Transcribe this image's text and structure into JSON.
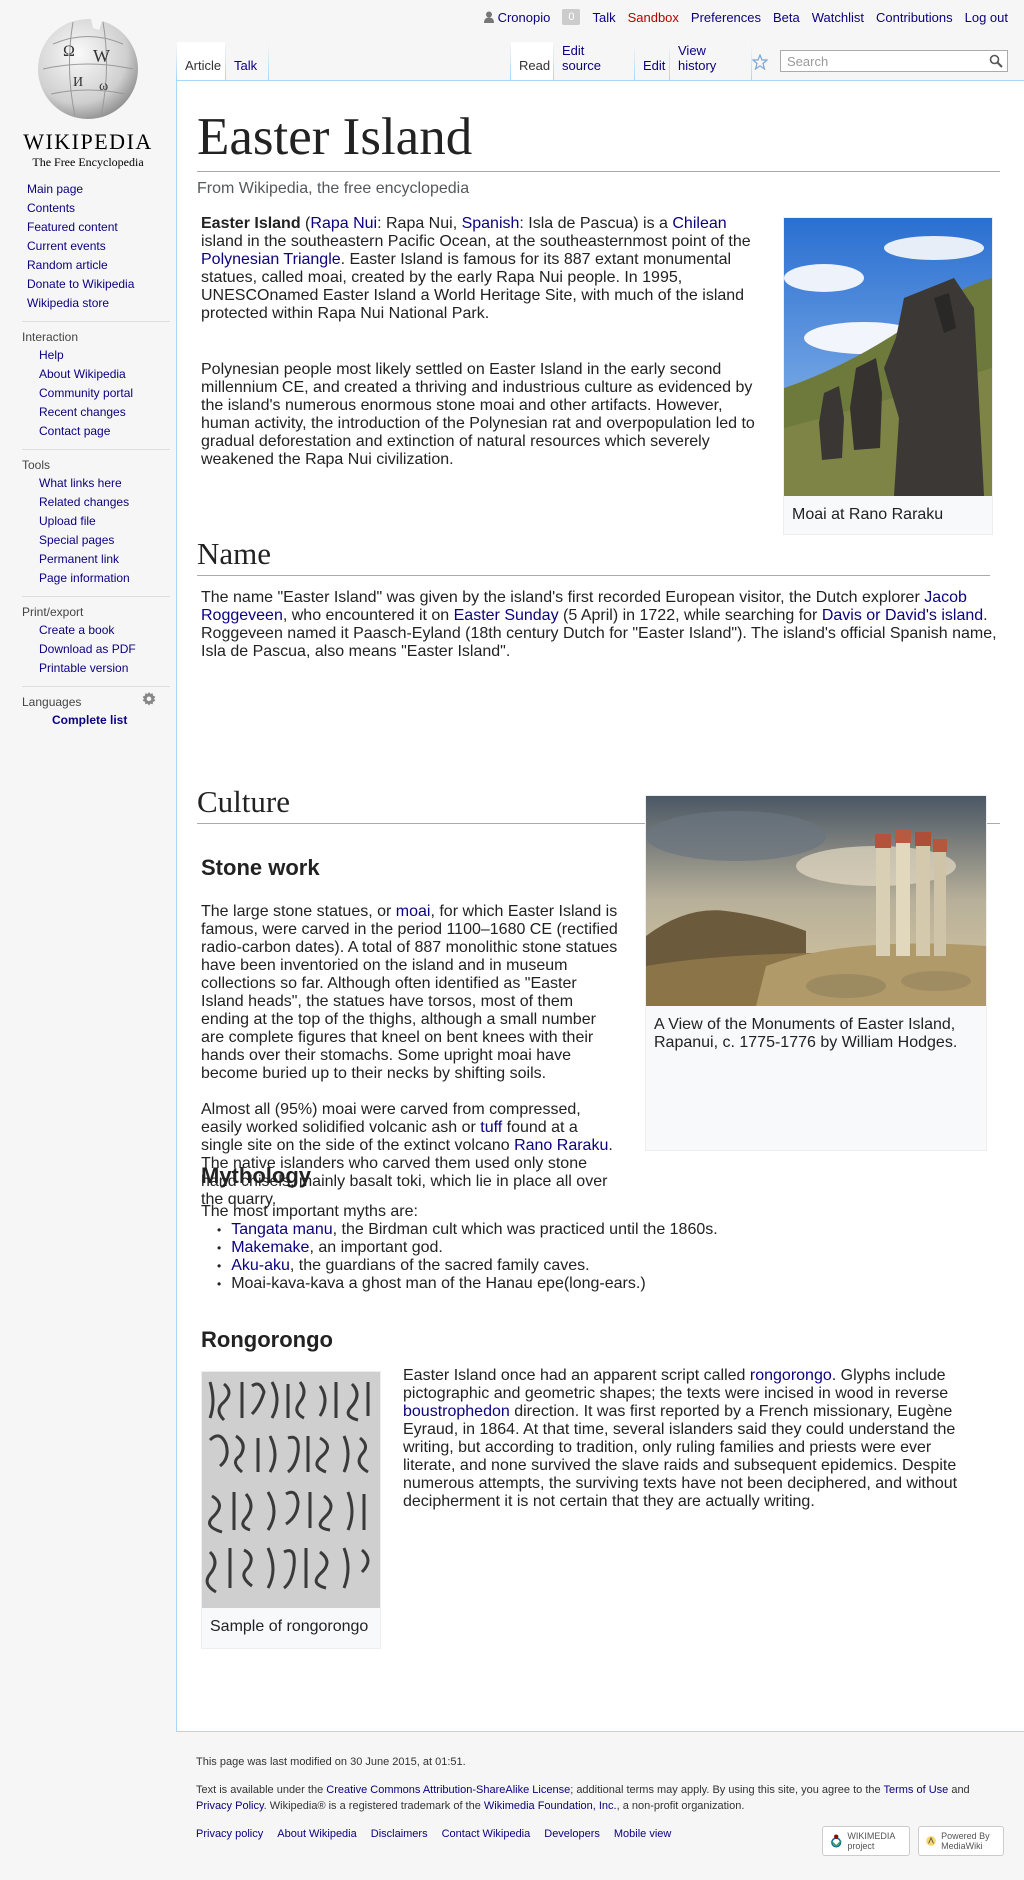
{
  "personal": {
    "username": "Cronopio",
    "notifications": "0",
    "talk": "Talk",
    "sandbox": "Sandbox",
    "preferences": "Preferences",
    "beta": "Beta",
    "watchlist": "Watchlist",
    "contributions": "Contributions",
    "logout": "Log out"
  },
  "logo": {
    "wordmark": "Wikipedia",
    "tagline": "The Free Encyclopedia"
  },
  "tabs": {
    "article": "Article",
    "talk": "Talk",
    "read": "Read",
    "edit_source": "Edit source",
    "edit": "Edit",
    "history": "View history"
  },
  "search": {
    "placeholder": "Search"
  },
  "sidebar": {
    "navigation": [
      "Main page",
      "Contents",
      "Featured content",
      "Current events",
      "Random article",
      "Donate to Wikipedia",
      "Wikipedia store"
    ],
    "interaction_heading": "Interaction",
    "interaction": [
      "Help",
      "About Wikipedia",
      "Community portal",
      "Recent changes",
      "Contact page"
    ],
    "tools_heading": "Tools",
    "tools": [
      "What links here",
      "Related changes",
      "Upload file",
      "Special pages",
      "Permanent link",
      "Page information"
    ],
    "print_heading": "Print/export",
    "print": [
      "Create a book",
      "Download as PDF",
      "Printable version"
    ],
    "languages_heading": "Languages",
    "languages_link": "Complete list"
  },
  "article": {
    "title": "Easter Island",
    "subtitle": "From Wikipedia, the free encyclopedia",
    "intro": {
      "bold": "Easter Island",
      "p1a": " (",
      "rapa_nui_link": "Rapa Nui",
      "p1b": ": Rapa Nui, ",
      "spanish_link": "Spanish",
      "p1c": ": Isla de Pascua) is a ",
      "chilean_link": "Chilean",
      "p1d": " island in the southeastern Pacific Ocean, at the southeasternmost point of the ",
      "polynesian_link": "Polynesian Triangle",
      "p1e": ". Easter Island is famous for its 887 extant monumental statues, called moai, created by the early Rapa Nui people. In 1995, UNESCOnamed Easter Island a World Heritage Site, with much of the island protected within Rapa Nui National Park.",
      "p2": "Polynesian people most likely settled on Easter Island in the early second millennium CE, and created a thriving and industrious culture as evidenced by the island's numerous enormous stone moai and other artifacts. However, human activity, the introduction of the Polynesian rat and overpopulation led to gradual deforestation and extinction of natural resources which severely weakened the Rapa Nui civilization."
    },
    "moai_caption": "Moai at Rano Raraku",
    "name_heading": "Name",
    "name_para": {
      "a": "The name \"Easter Island\" was given by the island's first recorded European visitor, the Dutch explorer ",
      "roggeveen_link": "Jacob Roggeveen",
      "b": ", who encountered it on ",
      "easter_link": "Easter Sunday",
      "c": " (5 April) in 1722, while searching for ",
      "davis_link": "Davis or David's island",
      "d": ". Roggeveen named it Paasch-Eyland (18th century Dutch for \"Easter Island\"). The island's official Spanish name, Isla de Pascua, also means \"Easter Island\"."
    },
    "culture_heading": "Culture",
    "stone_heading": "Stone work",
    "stone_p1": {
      "a": "The large stone statues, or ",
      "moai_link": "moai",
      "b": ", for which Easter Island is famous, were carved in the period 1100–1680 CE (rectified radio-carbon dates). A total of 887 monolithic stone statues have been inventoried on the island and in museum collections so far. Although often identified as \"Easter Island heads\", the statues have torsos, most of them ending at the top of the thighs, although a small number are complete figures that kneel on bent knees with their hands over their stomachs. Some upright moai have become buried up to their necks by shifting soils."
    },
    "stone_p2": {
      "a": "Almost all (95%) moai were carved from compressed, easily worked solidified volcanic ash or ",
      "tuff_link": "tuff",
      "b": " found at a single site on the side of the extinct volcano ",
      "rano_link": "Rano Raraku",
      "c": ". The native islanders who carved them used only stone hand chisels, mainly basalt toki, which lie in place all over the quarry."
    },
    "hodges_caption": "A View of the Monuments of Easter Island, Rapanui, c. 1775-1776 by William Hodges.",
    "mythology_heading": "Mythology",
    "mythology_intro": "The most important myths are:",
    "myths": [
      {
        "link": "Tangata manu",
        "text": ", the Birdman cult which was practiced until the 1860s."
      },
      {
        "link": "Makemake",
        "text": ", an important god."
      },
      {
        "link": "Aku-aku",
        "text": ", the guardians of the sacred family caves."
      },
      {
        "link": "",
        "text": "Moai-kava-kava a ghost man of the Hanau epe(long-ears.)"
      }
    ],
    "rongo_heading": "Rongorongo",
    "rongo_para": {
      "a": "Easter Island once had an apparent script called ",
      "rongo_link": "rongorongo",
      "b": ". Glyphs include pictographic and geometric shapes; the texts were incised in wood in reverse ",
      "bous_link": "boustrophedon",
      "c": " direction. It was first reported by a French missionary, Eugène Eyraud, in 1864. At that time, several islanders said they could understand the writing, but according to tradition, only ruling families and priests were ever literate, and none survived the slave raids and subsequent epidemics. Despite numerous attempts, the surviving texts have not been deciphered, and without decipherment it is not certain that they are actually writing."
    },
    "rongo_caption": "Sample of rongorongo"
  },
  "footer": {
    "modified": "This page was last modified on 30 June 2015, at 01:51.",
    "license_a": "Text is available under the ",
    "license_link": "Creative Commons Attribution-ShareAlike License",
    "license_b": "; additional terms may apply. By using this site, you agree to the ",
    "terms_link": "Terms of Use",
    "license_c": " and ",
    "privacy_link": "Privacy Policy",
    "license_d": ". Wikipedia® is a registered trademark of the ",
    "foundation_link": "Wikimedia Foundation, Inc.",
    "license_e": ", a non-profit organization.",
    "places": [
      "Privacy policy",
      "About Wikipedia",
      "Disclaimers",
      "Contact Wikipedia",
      "Developers",
      "Mobile view"
    ],
    "wikimedia_badge": "WIKIMEDIA project",
    "mediawiki_badge": "Powered By MediaWiki"
  }
}
